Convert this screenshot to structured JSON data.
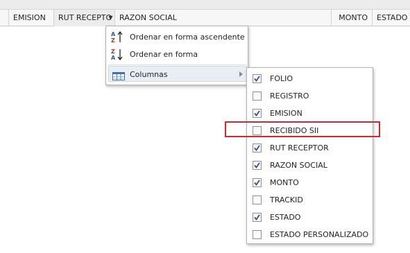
{
  "grid": {
    "columns": [
      {
        "key": "emision",
        "label": "EMISION"
      },
      {
        "key": "rut",
        "label": "RUT RECEPTO"
      },
      {
        "key": "razon",
        "label": "RAZON SOCIAL"
      },
      {
        "key": "monto",
        "label": "MONTO"
      },
      {
        "key": "estado",
        "label": "ESTADO"
      }
    ]
  },
  "menu": {
    "sort_asc": "Ordenar en forma ascendente",
    "sort_desc": "Ordenar en forma descendente",
    "columns": "Columnas"
  },
  "columns_menu": {
    "items": [
      {
        "label": "FOLIO",
        "checked": true
      },
      {
        "label": "REGISTRO",
        "checked": false
      },
      {
        "label": "EMISION",
        "checked": true
      },
      {
        "label": "RECIBIDO SII",
        "checked": false
      },
      {
        "label": "RUT RECEPTOR",
        "checked": true
      },
      {
        "label": "RAZON SOCIAL",
        "checked": true
      },
      {
        "label": "MONTO",
        "checked": true
      },
      {
        "label": "TRACKID",
        "checked": false
      },
      {
        "label": "ESTADO",
        "checked": true
      },
      {
        "label": "ESTADO PERSONALIZADO",
        "checked": false
      }
    ]
  },
  "colors": {
    "highlight": "#d9232d",
    "check": "#2d4f86"
  },
  "icons": {
    "sort_asc": "sort-az-ascending-icon",
    "sort_desc": "sort-za-descending-icon",
    "columns": "columns-icon",
    "submenu": "submenu-arrow-icon",
    "trigger": "column-menu-trigger-icon"
  }
}
